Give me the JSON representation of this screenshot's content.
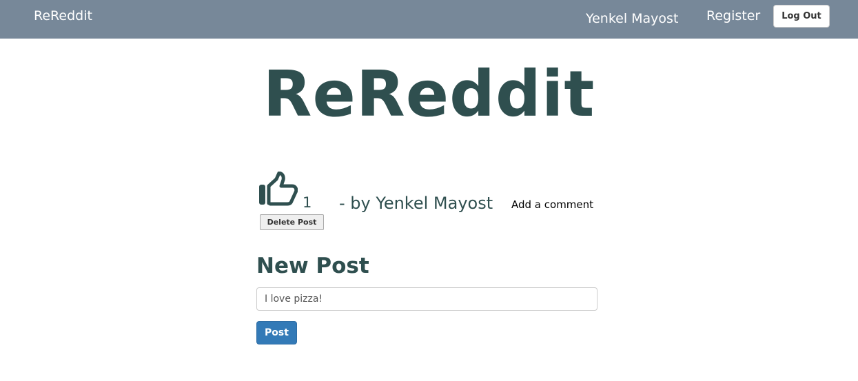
{
  "colors": {
    "navbar_bg": "#778899",
    "heading": "#2f4f4f",
    "primary_button": "#337ab7"
  },
  "navbar": {
    "brand": "ReReddit",
    "user_name": "Yenkel Mayost",
    "register_label": "Register",
    "logout_label": "Log Out"
  },
  "hero": {
    "title": "ReReddit"
  },
  "post": {
    "like_icon": "thumbs-up-icon",
    "like_count": "1",
    "author_line": "- by Yenkel Mayost",
    "add_comment_label": "Add a comment",
    "delete_label": "Delete Post"
  },
  "new_post": {
    "heading": "New Post",
    "input_value": "I love pizza!",
    "submit_label": "Post"
  }
}
